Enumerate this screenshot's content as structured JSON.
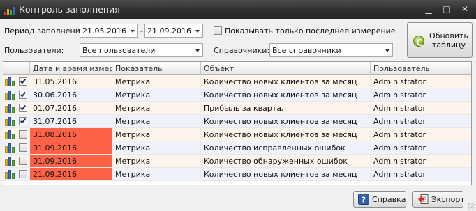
{
  "window": {
    "title": "Контроль заполнения"
  },
  "filters": {
    "period_label": "Период заполнения:",
    "date_from": "21.05.2016",
    "date_sep": "-",
    "date_to": "21.09.2016",
    "last_only_label": "Показывать только последнее измерение",
    "last_only_checked": false,
    "users_label": "Пользователи:",
    "users_value": "Все пользователи",
    "refs_label": "Справочники:",
    "refs_value": "Все справочники",
    "refresh_line1": "Обновить",
    "refresh_line2": "таблицу"
  },
  "table": {
    "columns": [
      "Дата и время измер…",
      "Показатель",
      "Объект",
      "Пользователь"
    ],
    "rows": [
      {
        "checked": true,
        "date": "31.05.2016",
        "indicator": "Метрика",
        "object": "Количество новых клиентов за месяц",
        "user": "Administrator",
        "overdue": false
      },
      {
        "checked": true,
        "date": "30.06.2016",
        "indicator": "Метрика",
        "object": "Количество новых клиентов за месяц",
        "user": "Administrator",
        "overdue": false
      },
      {
        "checked": true,
        "date": "01.07.2016",
        "indicator": "Метрика",
        "object": "Прибыль за квартал",
        "user": "Administrator",
        "overdue": false
      },
      {
        "checked": true,
        "date": "31.07.2016",
        "indicator": "Метрика",
        "object": "Количество новых клиентов за месяц",
        "user": "Administrator",
        "overdue": false
      },
      {
        "checked": false,
        "date": "31.08.2016",
        "indicator": "Метрика",
        "object": "Количество новых клиентов за месяц",
        "user": "Administrator",
        "overdue": true
      },
      {
        "checked": false,
        "date": "01.09.2016",
        "indicator": "Метрика",
        "object": "Количество исправленных ошибок",
        "user": "Administrator",
        "overdue": true
      },
      {
        "checked": false,
        "date": "01.09.2016",
        "indicator": "Метрика",
        "object": "Количество обнаруженных ошибок",
        "user": "Administrator",
        "overdue": true
      },
      {
        "checked": false,
        "date": "21.09.2016",
        "indicator": "Метрика",
        "object": "Количество новых клиентов за месяц",
        "user": "Administrator",
        "overdue": true
      }
    ]
  },
  "buttons": {
    "help": "Справка",
    "export": "Экспорт"
  },
  "colors": {
    "overdue": "#ff6347",
    "row_odd": "#fdf5ec",
    "row_even": "#f0f2fb",
    "title_bar": "#333333"
  },
  "icons": {
    "app": "bar-chart-icon",
    "minimize": "minimize-icon",
    "maximize": "maximize-icon",
    "close": "close-icon",
    "refresh": "refresh-icon",
    "row": "bar-chart-icon",
    "help": "help-icon",
    "export": "export-icon"
  }
}
